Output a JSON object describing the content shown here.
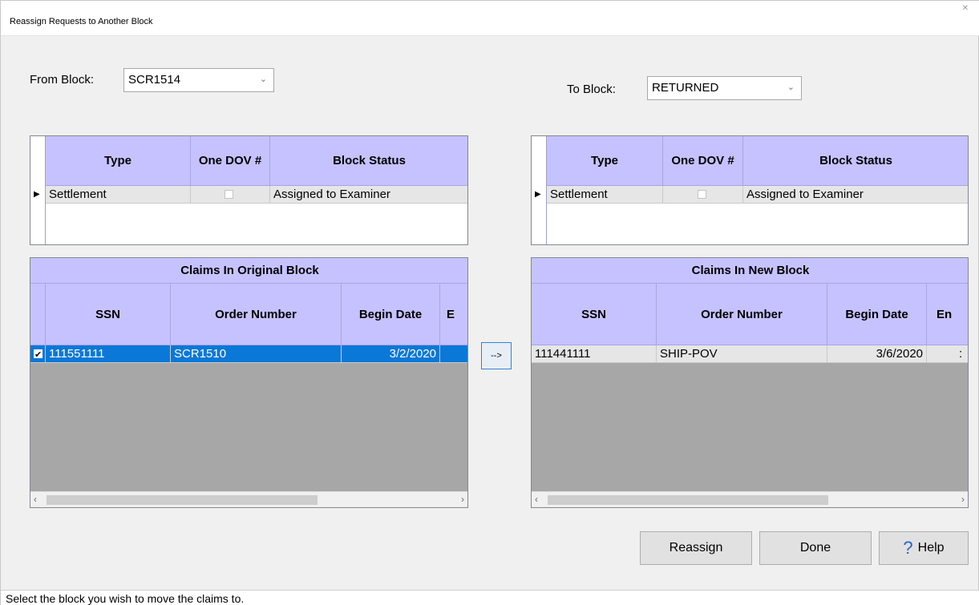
{
  "window": {
    "title": "Reassign Requests to Another Block"
  },
  "from_block": {
    "label": "From Block:",
    "value": "SCR1514"
  },
  "to_block": {
    "label": "To Block:",
    "value": "RETURNED"
  },
  "block_grid_columns": [
    "Type",
    "One DOV #",
    "Block Status"
  ],
  "from_block_row": {
    "type": "Settlement",
    "one_dov": false,
    "status": "Assigned to Examiner"
  },
  "to_block_row": {
    "type": "Settlement",
    "one_dov": false,
    "status": "Assigned to Examiner"
  },
  "original_claims": {
    "caption": "Claims In Original Block",
    "columns": [
      "SSN",
      "Order Number",
      "Begin Date",
      "E"
    ],
    "rows": [
      {
        "checked": true,
        "ssn": "111551111",
        "order": "SCR1510",
        "begin": "3/2/2020"
      }
    ]
  },
  "new_claims": {
    "caption": "Claims In New Block",
    "columns": [
      "SSN",
      "Order Number",
      "Begin Date",
      "En"
    ],
    "rows": [
      {
        "ssn": "111441111",
        "order": "SHIP-POV",
        "begin": "3/6/2020",
        "end_partial": ":"
      }
    ]
  },
  "move_button": {
    "label": "-->"
  },
  "buttons": {
    "reassign": "Reassign",
    "done": "Done",
    "help": "Help",
    "help_icon": "?"
  },
  "status_bar": "Select the block you wish to move the claims to.",
  "colors": {
    "header": "#c6c2ff",
    "selection": "#0a78d7",
    "grid_empty": "#a7a7a7"
  }
}
